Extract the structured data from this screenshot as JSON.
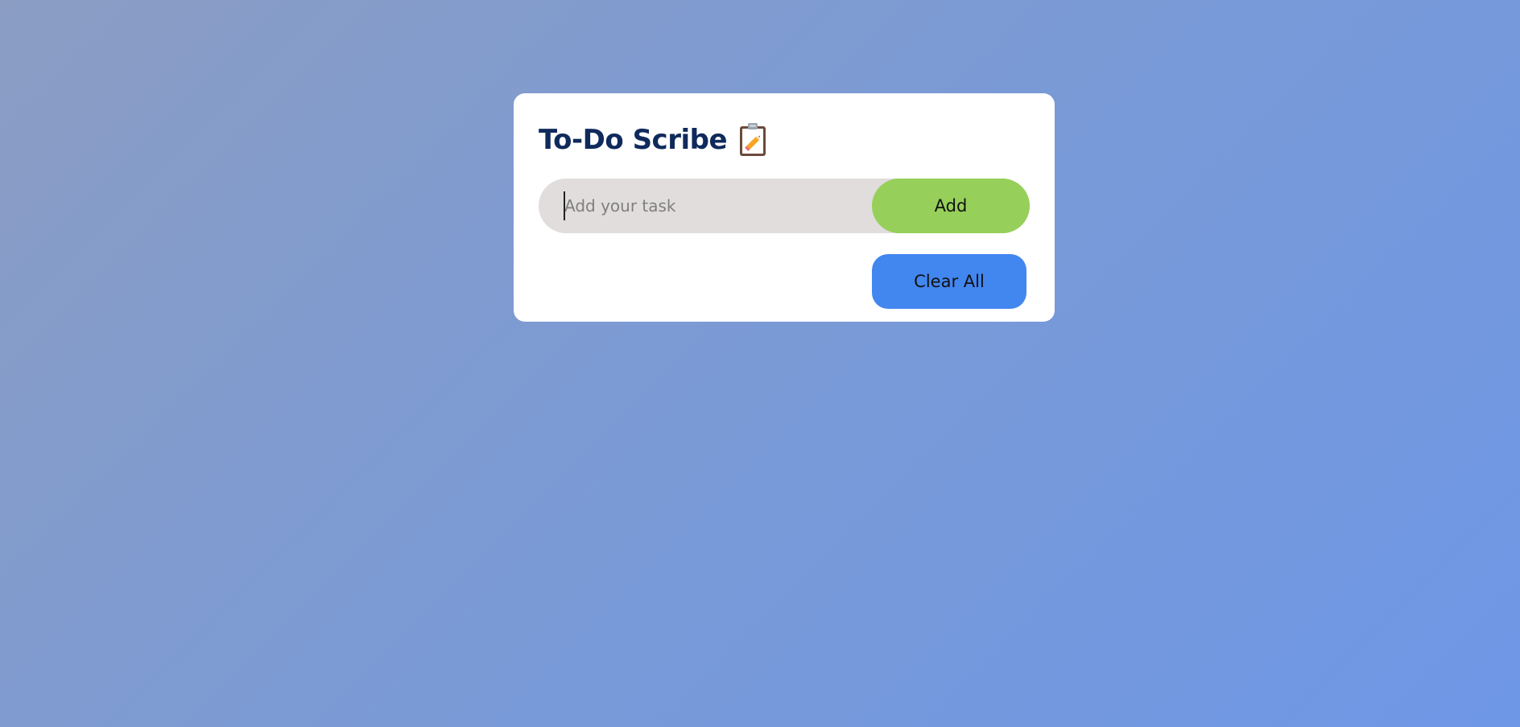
{
  "app": {
    "title": "To-Do Scribe",
    "title_icon": "clipboard-with-pencil-icon"
  },
  "task_form": {
    "input_value": "",
    "input_placeholder": "Add your task",
    "add_label": "Add"
  },
  "actions": {
    "clear_all_label": "Clear All"
  },
  "colors": {
    "title": "#0f2a5c",
    "add_button": "#96cf5a",
    "clear_button": "#4286f0",
    "input_background": "#e0dddc",
    "card_background": "#ffffff"
  }
}
